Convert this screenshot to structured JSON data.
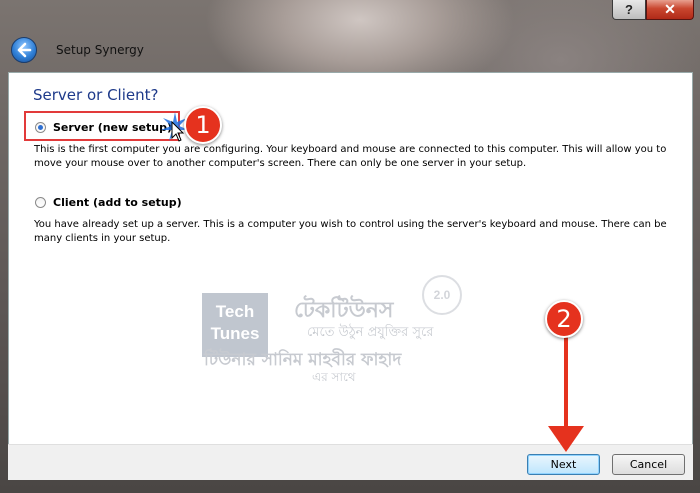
{
  "window": {
    "title": "Setup Synergy",
    "help_label": "?",
    "close_label": "✕"
  },
  "page": {
    "heading": "Server or Client?"
  },
  "options": [
    {
      "label": "Server (new setup)",
      "selected": true,
      "description": "This is the first computer you are configuring. Your keyboard and mouse are connected to this computer. This will allow you to move your mouse over to another computer's screen. There can only be one server in your setup."
    },
    {
      "label": "Client (add to setup)",
      "selected": false,
      "description": "You have already set up a server. This is a computer you wish to control using the server's keyboard and mouse. There can be many clients in your setup."
    }
  ],
  "buttons": {
    "next": "Next",
    "cancel": "Cancel"
  },
  "annotations": {
    "step1": "1",
    "step2": "2",
    "color": "#e5321e"
  },
  "watermark": {
    "logo_line1": "Tech",
    "logo_line2": "Tunes",
    "version": "2.0",
    "line1": "টেকটিউনস",
    "line2": "মেতে উঠুন প্রযুক্তির সুরে",
    "line3": "টিউনার সানিম মাহবীর ফাহাদ",
    "line4": "এর সাথে"
  }
}
